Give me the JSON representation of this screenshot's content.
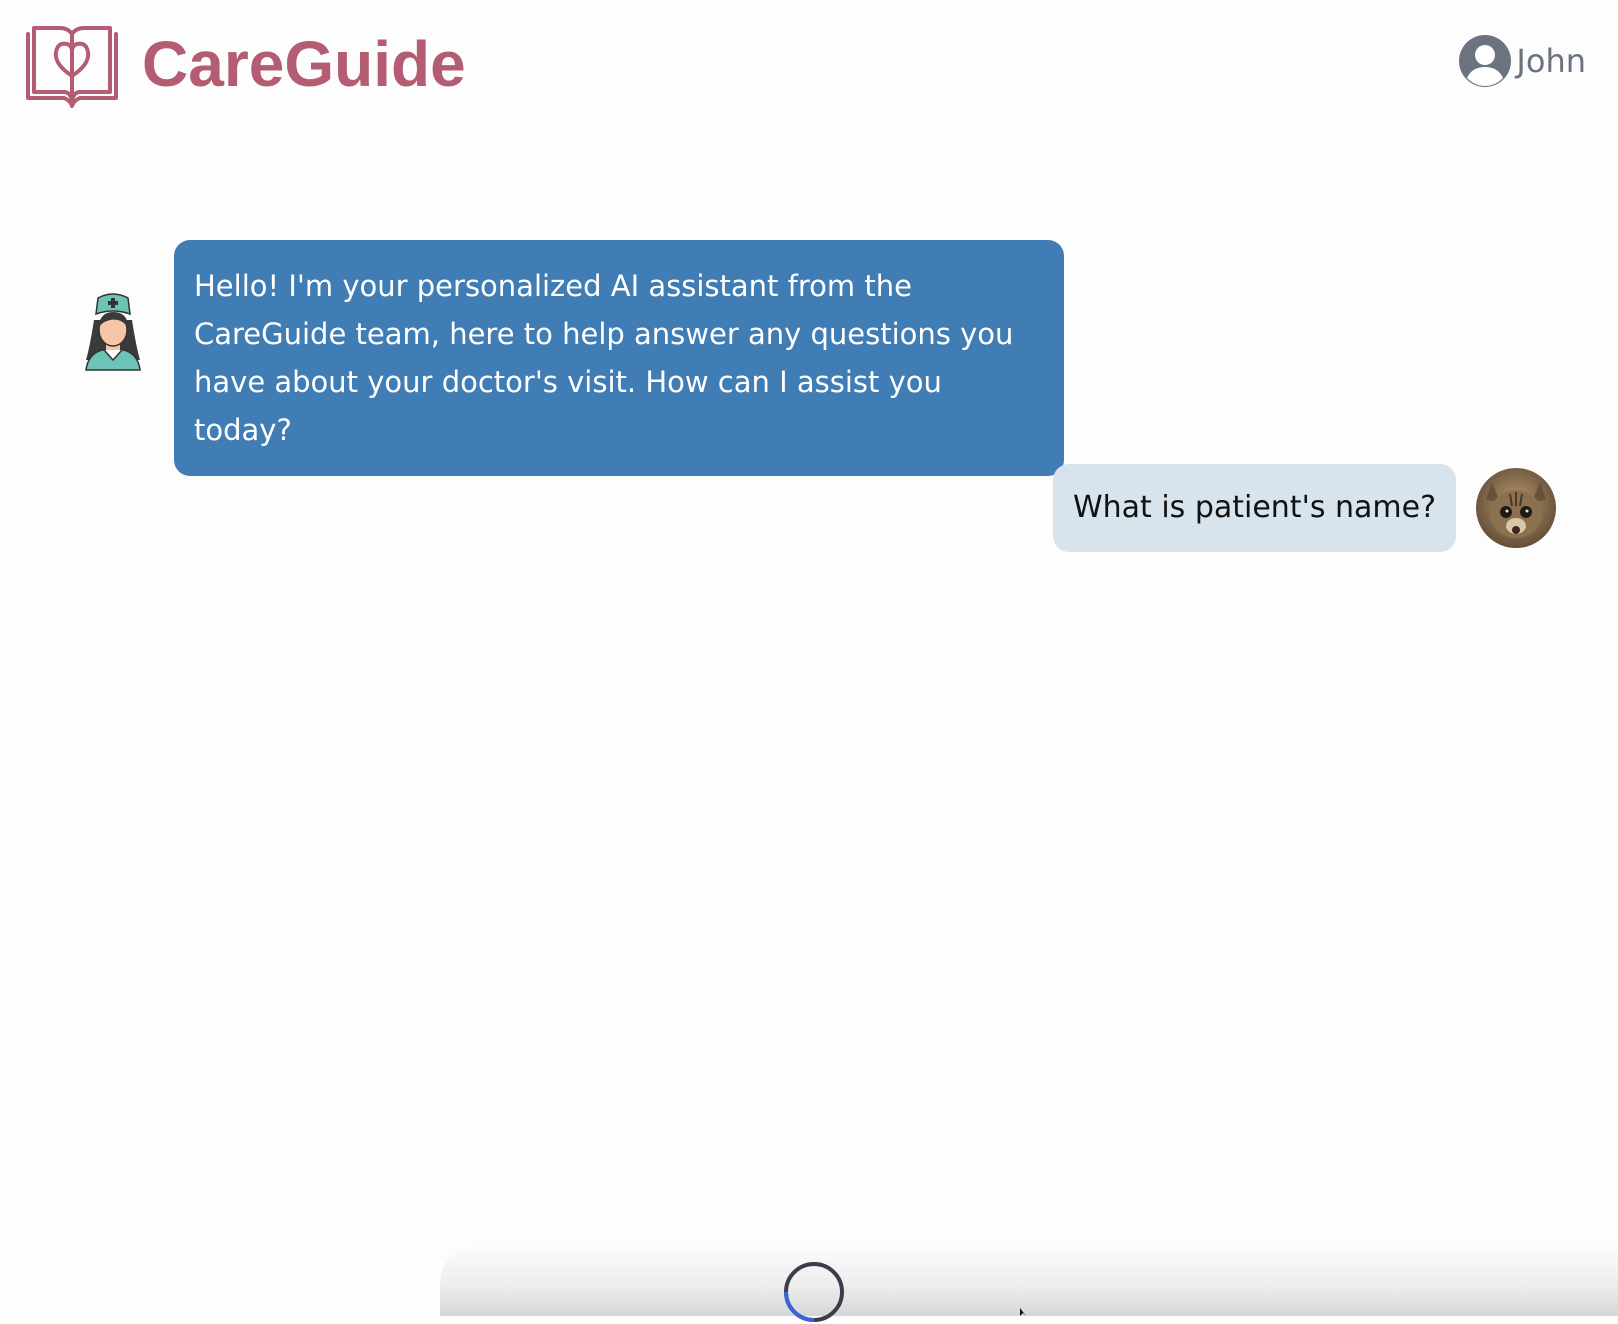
{
  "app": {
    "brand": "CareGuide",
    "brand_color": "#b35c72"
  },
  "header": {
    "user_name": "John",
    "user_icon": "user-circle-icon"
  },
  "chat": {
    "messages": [
      {
        "role": "assistant",
        "avatar": "nurse-avatar",
        "text": "Hello! I'm your personalized AI assistant from the CareGuide team, here to help answer any questions you have about your doctor's visit. How can I assist you today?",
        "bubble_color": "#417db5"
      },
      {
        "role": "user",
        "avatar": "cat-photo-avatar",
        "text": "What is patient's name?",
        "bubble_color": "#d7e4ed"
      }
    ]
  },
  "status": {
    "loading_icon": "loading-spinner-icon"
  }
}
